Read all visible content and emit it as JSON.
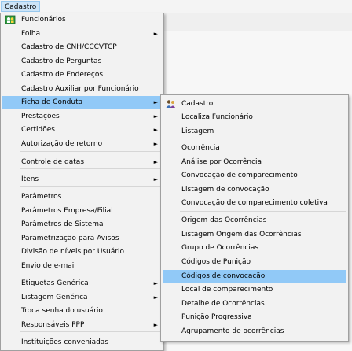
{
  "menubar": {
    "cadastro": "Cadastro"
  },
  "main_menu": {
    "funcionarios": "Funcionários",
    "folha": "Folha",
    "cnh": "Cadastro de CNH/CCCVTCP",
    "perguntas": "Cadastro de Perguntas",
    "enderecos": "Cadastro de Endereços",
    "auxiliar": "Cadastro Auxiliar por Funcionário",
    "ficha_conduta": "Ficha de Conduta",
    "prestacoes": "Prestações",
    "certidoes": "Certidões",
    "autorizacao": "Autorização de retorno",
    "controle_datas": "Controle de datas",
    "itens": "Itens",
    "parametros": "Parâmetros",
    "parametros_empresa": "Parâmetros Empresa/Filial",
    "parametros_sistema": "Parâmetros de Sistema",
    "parametrizacao_avisos": "Parametrização para Avisos",
    "divisao_niveis": "Divisão de níveis por Usuário",
    "envio_email": "Envio de e-mail",
    "etiquetas": "Etiquetas Genérica",
    "listagem_generica": "Listagem Genérica",
    "troca_senha": "Troca senha do usuário",
    "responsaveis_ppp": "Responsáveis PPP",
    "instituicoes": "Instituições conveniadas"
  },
  "sub_menu": {
    "cadastro": "Cadastro",
    "localiza": "Localiza Funcionário",
    "listagem": "Listagem",
    "ocorrencia": "Ocorrência",
    "analise": "Análise por Ocorrência",
    "convocacao_comp": "Convocação de comparecimento",
    "listagem_conv": "Listagem de convocação",
    "convocacao_coletiva": "Convocação de comparecimento coletiva",
    "origem": "Origem das Ocorrências",
    "listagem_origem": "Listagem Origem das Ocorrências",
    "grupo": "Grupo de Ocorrências",
    "codigos_punicao": "Códigos de Punição",
    "codigos_convocacao": "Códigos de convocação",
    "local": "Local de comparecimento",
    "detalhe": "Detalhe de Ocorrências",
    "punicao_progressiva": "Punição Progressiva",
    "agrupamento": "Agrupamento de ocorrências"
  },
  "arrow_glyph": "►",
  "colors": {
    "highlight": "#91c9f7",
    "menu_bg": "#f2f2f2",
    "menubar_active": "#cce4f7"
  },
  "icons": {
    "funcionarios": "people-icon",
    "cadastro": "people-icon"
  }
}
